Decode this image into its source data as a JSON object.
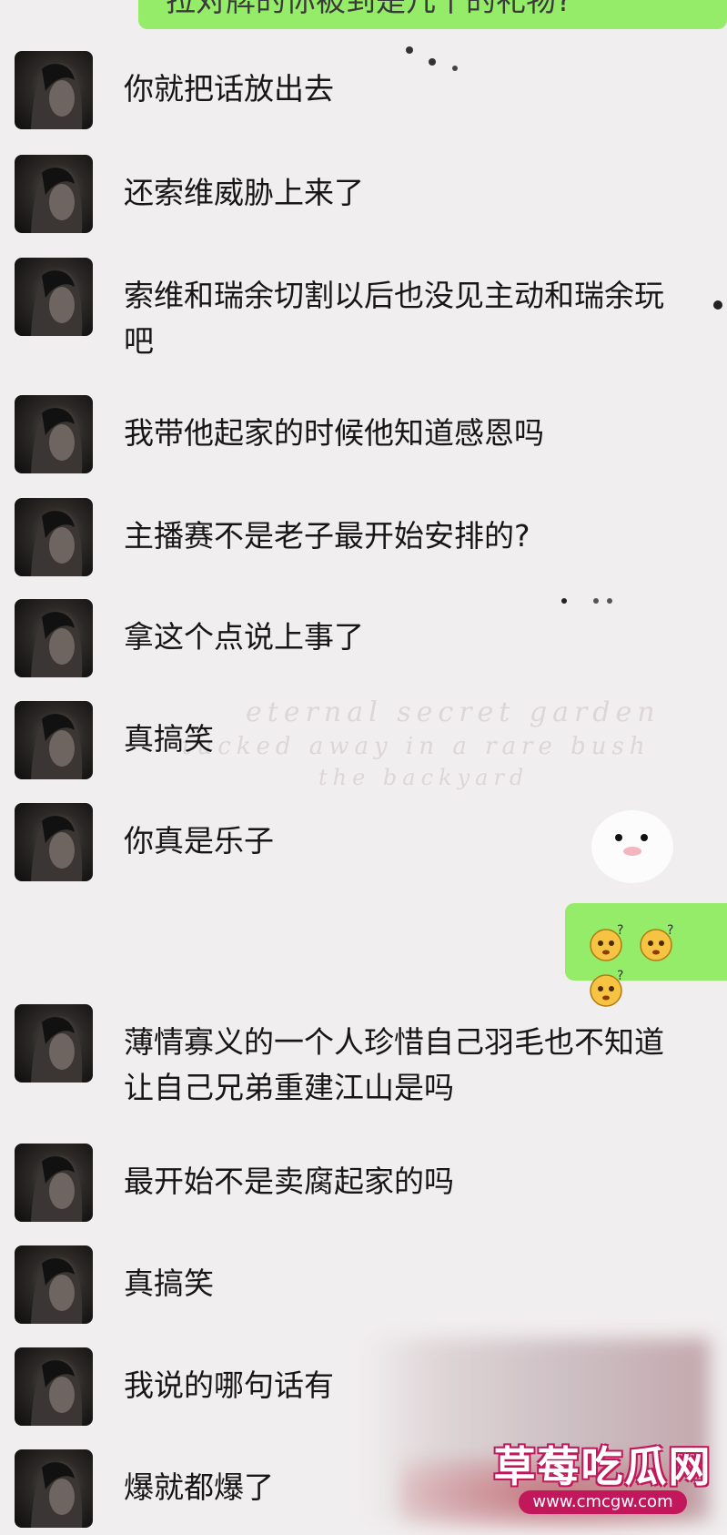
{
  "top_partial_message": "拉对牌的你被到是几千的礼物?",
  "messages": [
    {
      "id": "m1",
      "text": "你就把话放出去"
    },
    {
      "id": "m2",
      "text": "还索维威胁上来了"
    },
    {
      "id": "m3",
      "text": "索维和瑞余切割以后也没见主动和瑞余玩吧"
    },
    {
      "id": "m4",
      "text": "我带他起家的时候他知道感恩吗"
    },
    {
      "id": "m5",
      "text": "主播赛不是老子最开始安排的?"
    },
    {
      "id": "m6",
      "text": "拿这个点说上事了"
    },
    {
      "id": "m7",
      "text": "真搞笑"
    },
    {
      "id": "m8",
      "text": "你真是乐子"
    },
    {
      "id": "m9",
      "text": "薄情寡义的一个人珍惜自己羽毛也不知道让自己兄弟重建江山是吗"
    },
    {
      "id": "m10",
      "text": "最开始不是卖腐起家的吗"
    },
    {
      "id": "m11",
      "text": "真搞笑"
    },
    {
      "id": "m12",
      "text": "我说的哪句话有"
    },
    {
      "id": "m13",
      "text": "爆就都爆了"
    }
  ],
  "self_message": {
    "emoji_icons": [
      "confused-face-icon",
      "confused-face-icon",
      "confused-face-icon"
    ]
  },
  "background_script": [
    "eternal secret garden",
    "tucked away in a rare bush",
    "the backyard"
  ],
  "watermark": {
    "main": "草莓吃瓜网",
    "sub": "www.cmcgw.com"
  },
  "colors": {
    "self_bubble": "#95ec69",
    "background": "#f1eeef",
    "watermark": "#c2185b"
  }
}
